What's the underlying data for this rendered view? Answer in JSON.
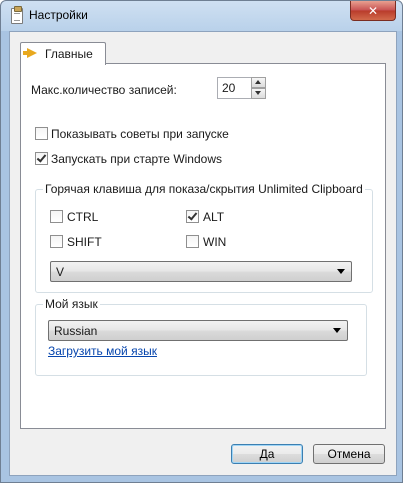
{
  "window": {
    "title": "Настройки",
    "close_glyph": "✕"
  },
  "tabs": [
    {
      "label": "Главные"
    }
  ],
  "general": {
    "max_records_label": "Макс.количество записей:",
    "max_records_value": "20",
    "show_tips_label": "Показывать советы при запуске",
    "show_tips_checked": false,
    "run_at_startup_label": "Запускать при старте Windows",
    "run_at_startup_checked": true
  },
  "hotkey_group": {
    "title": "Горячая клавиша для показа/скрытия Unlimited Clipboard",
    "ctrl_label": "CTRL",
    "ctrl_checked": false,
    "alt_label": "ALT",
    "alt_checked": true,
    "shift_label": "SHIFT",
    "shift_checked": false,
    "win_label": "WIN",
    "win_checked": false,
    "key_value": "V"
  },
  "language_group": {
    "title": "Мой язык",
    "selected_language": "Russian",
    "load_link": "Загрузить мой язык"
  },
  "buttons": {
    "ok_label": "Да",
    "cancel_label": "Отмена"
  },
  "icons": {
    "window_icon": "clipboard-icon",
    "tab_icon": "arrow-right-icon"
  }
}
